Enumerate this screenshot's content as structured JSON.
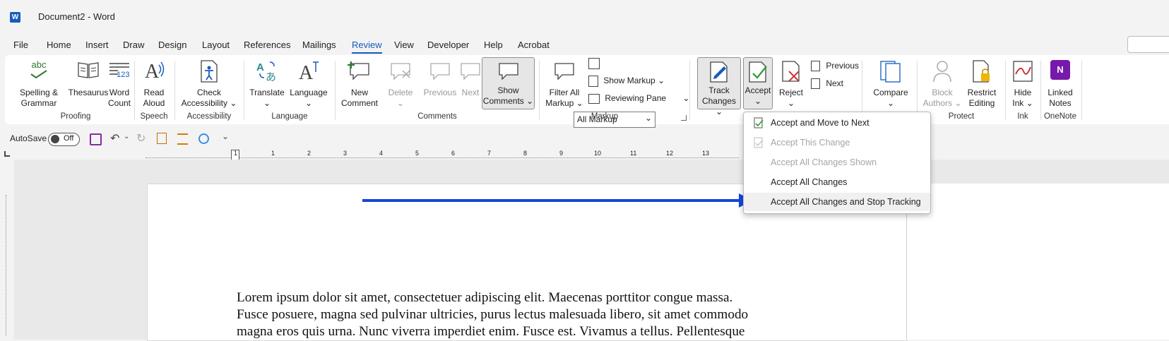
{
  "window": {
    "title": "Document2  -  Word",
    "app_icon": "W"
  },
  "menu": {
    "items": [
      "File",
      "Home",
      "Insert",
      "Draw",
      "Design",
      "Layout",
      "References",
      "Mailings",
      "Review",
      "View",
      "Developer",
      "Help",
      "Acrobat"
    ],
    "active": "Review"
  },
  "ribbon": {
    "proofing": {
      "spelling": "Spelling &",
      "spelling2": "Grammar",
      "thesaurus": "Thesaurus",
      "wordcount": "Word",
      "wordcount2": "Count",
      "abc": "abc",
      "num": "123",
      "label": "Proofing"
    },
    "speech": {
      "read": "Read",
      "read2": "Aloud",
      "label": "Speech"
    },
    "accessibility": {
      "check": "Check",
      "check2": "Accessibility",
      "label": "Accessibility"
    },
    "language": {
      "translate": "Translate",
      "language": "Language",
      "label": "Language"
    },
    "comments": {
      "new": "New",
      "new2": "Comment",
      "delete": "Delete",
      "previous": "Previous",
      "next": "Next",
      "show": "Show",
      "show2": "Comments",
      "label": "Comments"
    },
    "markup": {
      "filter": "Filter All",
      "filter2": "Markup",
      "dropdown_value": "All Markup",
      "show_markup": "Show Markup",
      "reviewing_pane": "Reviewing Pane",
      "label": "Markup"
    },
    "tracking": {
      "track": "Track",
      "track2": "Changes",
      "accept": "Accept",
      "reject": "Reject",
      "previous": "Previous",
      "next": "Next"
    },
    "compare": {
      "compare": "Compare"
    },
    "protect": {
      "block": "Block",
      "block2": "Authors",
      "restrict": "Restrict",
      "restrict2": "Editing",
      "label": "Protect"
    },
    "ink": {
      "hide": "Hide",
      "hide2": "Ink",
      "label": "Ink"
    },
    "onenote": {
      "linked": "Linked",
      "linked2": "Notes",
      "label": "OneNote"
    }
  },
  "qat": {
    "autosave_label": "AutoSave",
    "autosave_state": "Off"
  },
  "ruler": {
    "numbers": [
      "1",
      "1",
      "2",
      "3",
      "4",
      "5",
      "6",
      "7",
      "8",
      "9",
      "10",
      "11",
      "12",
      "13"
    ]
  },
  "accept_menu": {
    "items": [
      {
        "label": "Accept and Move to Next",
        "enabled": true
      },
      {
        "label": "Accept This Change",
        "enabled": false
      },
      {
        "label": "Accept All Changes Shown",
        "enabled": false
      },
      {
        "label": "Accept All Changes",
        "enabled": true
      },
      {
        "label": "Accept All Changes and Stop Tracking",
        "enabled": true
      }
    ]
  },
  "document": {
    "lines": [
      "Lorem ipsum dolor sit amet, consectetuer adipiscing elit. Maecenas porttitor congue massa.",
      "Fusce posuere, magna sed pulvinar ultricies, purus lectus malesuada libero, sit amet commodo",
      "magna eros quis urna. Nunc viverra imperdiet enim. Fusce est. Vivamus a tellus. Pellentesque"
    ]
  },
  "colors": {
    "accent": "#185abd",
    "arrow": "#1346e0"
  }
}
